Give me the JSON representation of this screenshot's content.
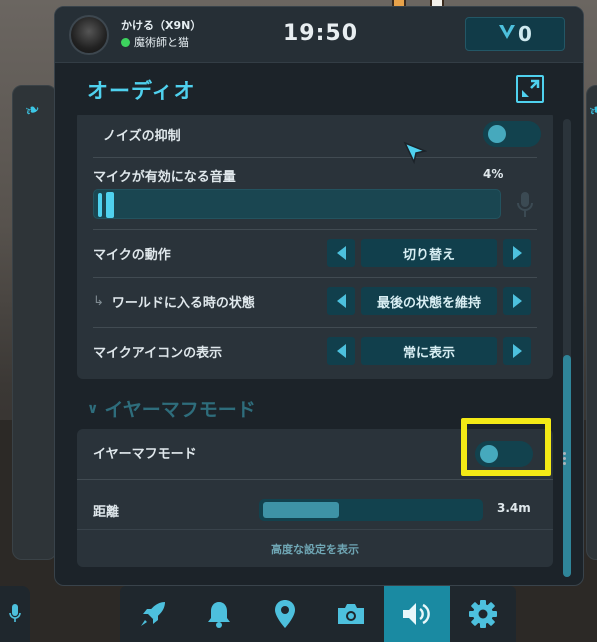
{
  "user": {
    "name": "かける（X9N）",
    "status": "魔術師と猫"
  },
  "clock": "19:50",
  "currency": {
    "value": "0",
    "icon": "v-currency-icon"
  },
  "panel": {
    "title": "オーディオ"
  },
  "audio": {
    "noise_suppression": {
      "label": "ノイズの抑制",
      "enabled": true
    },
    "mic_threshold": {
      "label": "マイクが有効になる音量",
      "value": "4%",
      "fraction": 0.04
    },
    "mic_behavior": {
      "label": "マイクの動作",
      "value": "切り替え"
    },
    "world_join_state": {
      "label": "ワールドに入る時の状態",
      "value": "最後の状態を維持"
    },
    "mic_icon_display": {
      "label": "マイクアイコンの表示",
      "value": "常に表示"
    }
  },
  "earmuff": {
    "section_title": "イヤーマフモード",
    "mode": {
      "label": "イヤーマフモード",
      "enabled": false
    },
    "distance": {
      "label": "距離",
      "value": "3.4m",
      "fraction": 0.35
    },
    "advanced_link": "高度な設定を表示"
  },
  "dock": {
    "items": [
      {
        "icon": "rocket-icon",
        "active": false
      },
      {
        "icon": "bell-icon",
        "active": false
      },
      {
        "icon": "location-pin-icon",
        "active": false
      },
      {
        "icon": "camera-icon",
        "active": false
      },
      {
        "icon": "speaker-icon",
        "active": true
      },
      {
        "icon": "gear-icon",
        "active": false
      }
    ]
  },
  "colors": {
    "accent": "#4fd1ee",
    "highlight": "#f4ea16",
    "panel": "#2a333a",
    "active_tab": "#1a8aa2"
  }
}
